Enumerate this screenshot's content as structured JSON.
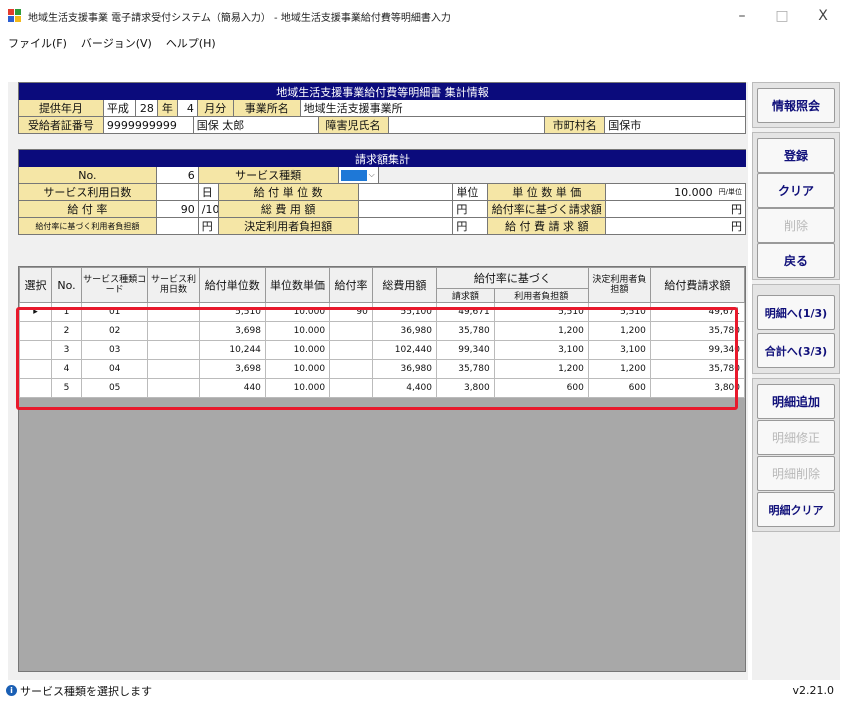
{
  "window": {
    "title": "地域生活支援事業 電子請求受付システム（簡易入力） - 地域生活支援事業給付費等明細書入力",
    "minimize": "–",
    "maximize": "□",
    "close": "X"
  },
  "menu": [
    "ファイル(F)",
    "バージョン(V)",
    "ヘルプ(H)"
  ],
  "summary": {
    "header": "地域生活支援事業給付費等明細書 集計情報",
    "row1": {
      "provision_label": "提供年月",
      "era": "平成",
      "year": "28",
      "year_unit": "年",
      "month": "4",
      "month_unit": "月分",
      "office_label": "事業所名",
      "office_value": "地域生活支援事業所"
    },
    "row2": {
      "cert_label": "受給者証番号",
      "cert_value": "9999999999",
      "name_value": "国保 太郎",
      "child_label": "障害児氏名",
      "child_value": "",
      "city_label": "市町村名",
      "city_value": "国保市"
    }
  },
  "billing": {
    "header": "請求額集計",
    "row1": {
      "no_label": "No.",
      "no_value": "6",
      "service_type_label": "サービス種類",
      "service_type_value": ""
    },
    "row2": {
      "days_label": "サービス利用日数",
      "days_unit": "日",
      "units_label": "給 付 単 位 数",
      "unit_label": "単位",
      "unit_price_label": "単 位 数 単 価",
      "unit_price_value": "10.000",
      "unit_price_suffix": "円/単位"
    },
    "row3": {
      "rate_label": "給 付 率",
      "rate_value": "90",
      "rate_suffix": "/100",
      "total_label": "総 費 用 額",
      "yen1": "円",
      "rate_claim_label": "給付率に基づく請求額",
      "yen2": "円"
    },
    "row4": {
      "share_label": "給付率に基づく利用者負担額",
      "yen1": "円",
      "decided_label": "決定利用者負担額",
      "yen2": "円",
      "claim_label": "給 付 費 請 求 額",
      "yen3": "円"
    }
  },
  "detail": {
    "columns": {
      "select": "選択",
      "no": "No.",
      "code": "サービス種類コード",
      "days": "サービス利用日数",
      "units": "給付単位数",
      "unit_price": "単位数単価",
      "rate": "給付率",
      "total": "総費用額",
      "group": "給付率に基づく",
      "claim": "請求額",
      "share": "利用者負担額",
      "decided": "決定利用者負担額",
      "payment": "給付費請求額"
    },
    "rows": [
      {
        "sel": "▸",
        "no": "1",
        "code": "01",
        "days": "",
        "units": "5,510",
        "unit_price": "10.000",
        "rate": "90",
        "total": "55,100",
        "claim": "49,671",
        "share": "5,510",
        "decided": "5,510",
        "payment": "49,671"
      },
      {
        "sel": "",
        "no": "2",
        "code": "02",
        "days": "",
        "units": "3,698",
        "unit_price": "10.000",
        "rate": "",
        "total": "36,980",
        "claim": "35,780",
        "share": "1,200",
        "decided": "1,200",
        "payment": "35,780"
      },
      {
        "sel": "",
        "no": "3",
        "code": "03",
        "days": "",
        "units": "10,244",
        "unit_price": "10.000",
        "rate": "",
        "total": "102,440",
        "claim": "99,340",
        "share": "3,100",
        "decided": "3,100",
        "payment": "99,340"
      },
      {
        "sel": "",
        "no": "4",
        "code": "04",
        "days": "",
        "units": "3,698",
        "unit_price": "10.000",
        "rate": "",
        "total": "36,980",
        "claim": "35,780",
        "share": "1,200",
        "decided": "1,200",
        "payment": "35,780"
      },
      {
        "sel": "",
        "no": "5",
        "code": "05",
        "days": "",
        "units": "440",
        "unit_price": "10.000",
        "rate": "",
        "total": "4,400",
        "claim": "3,800",
        "share": "600",
        "decided": "600",
        "payment": "3,800"
      }
    ]
  },
  "sidebar": {
    "info": "情報照会",
    "register": "登録",
    "clear": "クリア",
    "delete": "削除",
    "back": "戻る",
    "next_detail": "明細へ(1/3)",
    "totals": "合計へ(3/3)",
    "add_detail": "明細追加",
    "edit_detail": "明細修正",
    "delete_detail": "明細削除",
    "clear_detail": "明細クリア"
  },
  "status": {
    "icon": "i",
    "message": "サービス種類を選択します",
    "version": "v2.21.0"
  },
  "colors": {
    "header_bg": "#0b0b7c",
    "label_bg": "#f5e6a6",
    "highlight": "#e8192c",
    "button_text": "#10107a"
  }
}
